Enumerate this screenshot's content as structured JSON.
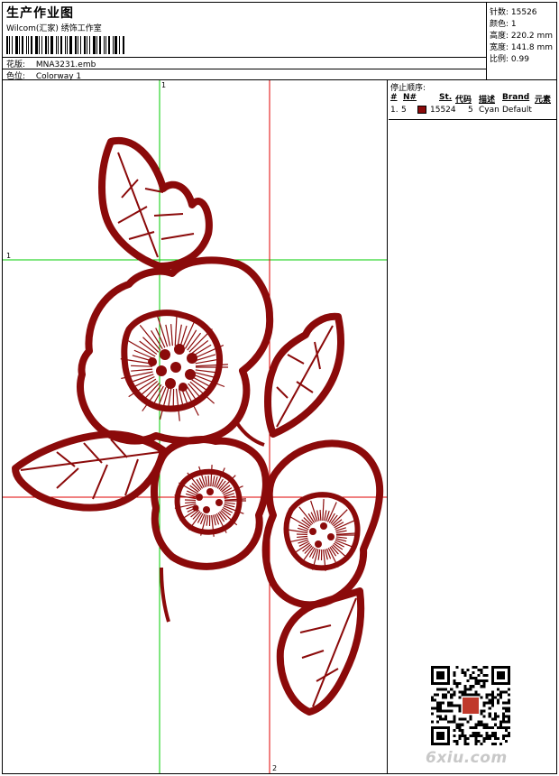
{
  "header": {
    "title": "生产作业图",
    "subtitle": "Wilcom(汇家) 绣饰工作室",
    "design_label": "花版:",
    "design_value": "MNA3231.emb",
    "colorway_label": "色位:",
    "colorway_value": "Colorway 1"
  },
  "stats": {
    "stitches": "针数: 15526",
    "colors": "颜色: 1",
    "height": "高度: 220.2 mm",
    "width": "宽度: 141.8 mm",
    "scale": "比例: 0.99"
  },
  "stop_sequence": {
    "title": "停止顺序:",
    "columns": [
      "#",
      "N#",
      "St.",
      "代码",
      "描述",
      "Brand",
      "元素"
    ],
    "rows": [
      {
        "index": "1.",
        "needle": "5",
        "stitches": "15524",
        "code": "5",
        "description": "Cyan",
        "brand": "Default",
        "color": "#8b0a0a"
      }
    ]
  },
  "guides": {
    "top_marker": "1",
    "left_marker": "1",
    "bottom_marker": "2"
  },
  "design_color": "#8b0a0a",
  "watermark": "6xiu.com",
  "seal_text": "四山"
}
